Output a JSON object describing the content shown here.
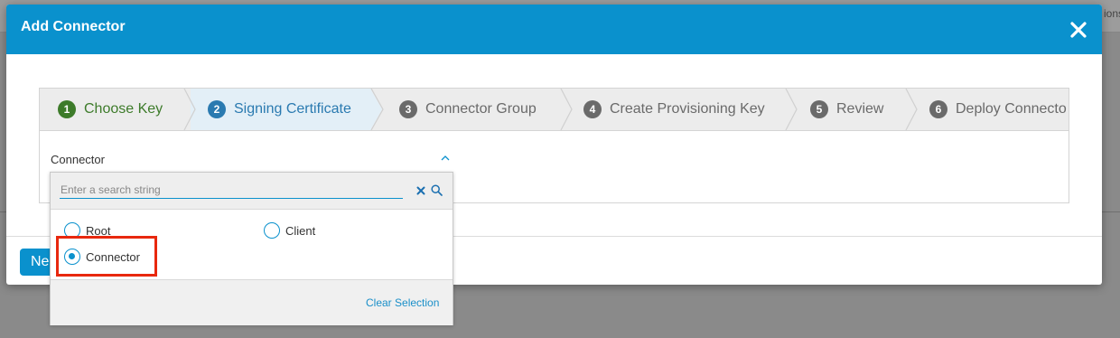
{
  "background": {
    "top_right_text": "ions"
  },
  "modal": {
    "title": "Add Connector",
    "next_label": "Ne"
  },
  "wizard": {
    "steps": [
      {
        "num": "1",
        "label": "Choose Key",
        "state": "done"
      },
      {
        "num": "2",
        "label": "Signing Certificate",
        "state": "active"
      },
      {
        "num": "3",
        "label": "Connector Group",
        "state": "pending"
      },
      {
        "num": "4",
        "label": "Create Provisioning Key",
        "state": "pending"
      },
      {
        "num": "5",
        "label": "Review",
        "state": "pending"
      },
      {
        "num": "6",
        "label": "Deploy Connecto",
        "state": "pending"
      }
    ],
    "field_label": "Connector"
  },
  "dropdown": {
    "search_placeholder": "Enter a search string",
    "options": [
      {
        "label": "Root",
        "checked": false
      },
      {
        "label": "Client",
        "checked": false
      },
      {
        "label": "Connector",
        "checked": true
      }
    ],
    "clear_selection": "Clear Selection"
  },
  "colors": {
    "header": "#0a91cd",
    "done": "#3d7b2a",
    "active": "#2a7ab0",
    "highlight": "#e8280e"
  }
}
